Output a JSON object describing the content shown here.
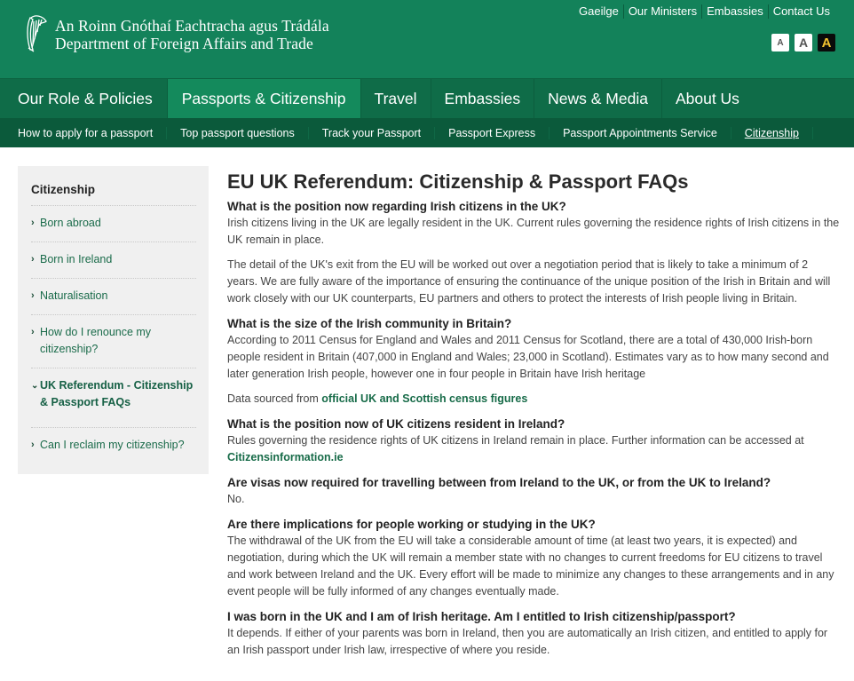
{
  "header": {
    "logo_line1": "An Roinn Gnóthaí Eachtracha agus Trádála",
    "logo_line2": "Department of Foreign Affairs and Trade",
    "util_links": [
      "Gaeilge",
      "Our Ministers",
      "Embassies",
      "Contact Us"
    ],
    "text_size_buttons": [
      "A",
      "A",
      "A"
    ]
  },
  "main_nav": {
    "items": [
      "Our Role & Policies",
      "Passports & Citizenship",
      "Travel",
      "Embassies",
      "News & Media",
      "About Us"
    ],
    "active": "Passports & Citizenship"
  },
  "sub_nav": {
    "items": [
      "How to apply for a passport",
      "Top passport questions",
      "Track your Passport",
      "Passport Express",
      "Passport Appointments Service",
      "Citizenship"
    ],
    "current": "Citizenship"
  },
  "sidebar": {
    "title": "Citizenship",
    "items": [
      {
        "label": "Born abroad"
      },
      {
        "label": "Born in Ireland"
      },
      {
        "label": "Naturalisation"
      },
      {
        "label": "How do I renounce my citizenship?"
      },
      {
        "label": "UK Referendum - Citizenship & Passport FAQs",
        "active": true
      },
      {
        "label": "Can I reclaim my citizenship?"
      }
    ]
  },
  "main": {
    "title": "EU UK Referendum: Citizenship & Passport FAQs",
    "faqs": [
      {
        "q": "What is the position now regarding Irish citizens in the UK?",
        "a1": "Irish citizens living in the UK are legally resident in the UK. Current rules governing the residence rights of Irish citizens in the UK remain in place.",
        "a2": "The detail of the UK's exit from the EU will be worked out over a negotiation period that is likely to take a minimum of 2 years. We are fully aware of the importance of ensuring the continuance of the unique position of the Irish in Britain and will work closely with our UK counterparts, EU partners and others to protect the interests of Irish people living in Britain."
      },
      {
        "q": "What is the size of the Irish community in Britain?",
        "a1": "According to 2011 Census for England and Wales and 2011 Census for Scotland, there are a total of 430,000 Irish-born people resident in Britain (407,000 in England and Wales; 23,000 in Scotland). Estimates vary as to how many second and later generation Irish people, however one in four people in Britain have Irish heritage",
        "a2_prefix": "Data sourced from ",
        "a2_link": "official UK and Scottish census figures"
      },
      {
        "q": "What is the position now of UK citizens resident in Ireland?",
        "a1": "Rules governing the residence rights of UK citizens in Ireland remain in place. Further information can be accessed at ",
        "a1_link": "Citizensinformation.ie"
      },
      {
        "q": "Are visas now required for travelling between from Ireland to the UK, or from the UK to Ireland?",
        "a1": "No."
      },
      {
        "q": "Are there implications for people working or studying in the UK?",
        "a1": "The withdrawal of the UK from the EU will take a considerable amount of time (at least two years, it is expected) and negotiation, during which the UK will remain a member state with no changes to current freedoms for EU citizens to travel and work between Ireland and the UK. Every effort will be made to minimize any changes to these arrangements and in any event people will be fully informed of any changes eventually made."
      },
      {
        "q": "I was born in the UK and I am of Irish heritage. Am I entitled to Irish citizenship/passport?",
        "a1": "It depends. If either of your parents was born in Ireland, then you are automatically an Irish citizen, and entitled to apply for an Irish passport under Irish law, irrespective of where you reside."
      }
    ]
  },
  "colors": {
    "header_green": "#13825a",
    "nav_green": "#0f6c48",
    "subnav_green": "#0b5a3b",
    "active_tab": "#148a5c",
    "link_green": "#176b48",
    "high_contrast_a": "#f2c230"
  }
}
